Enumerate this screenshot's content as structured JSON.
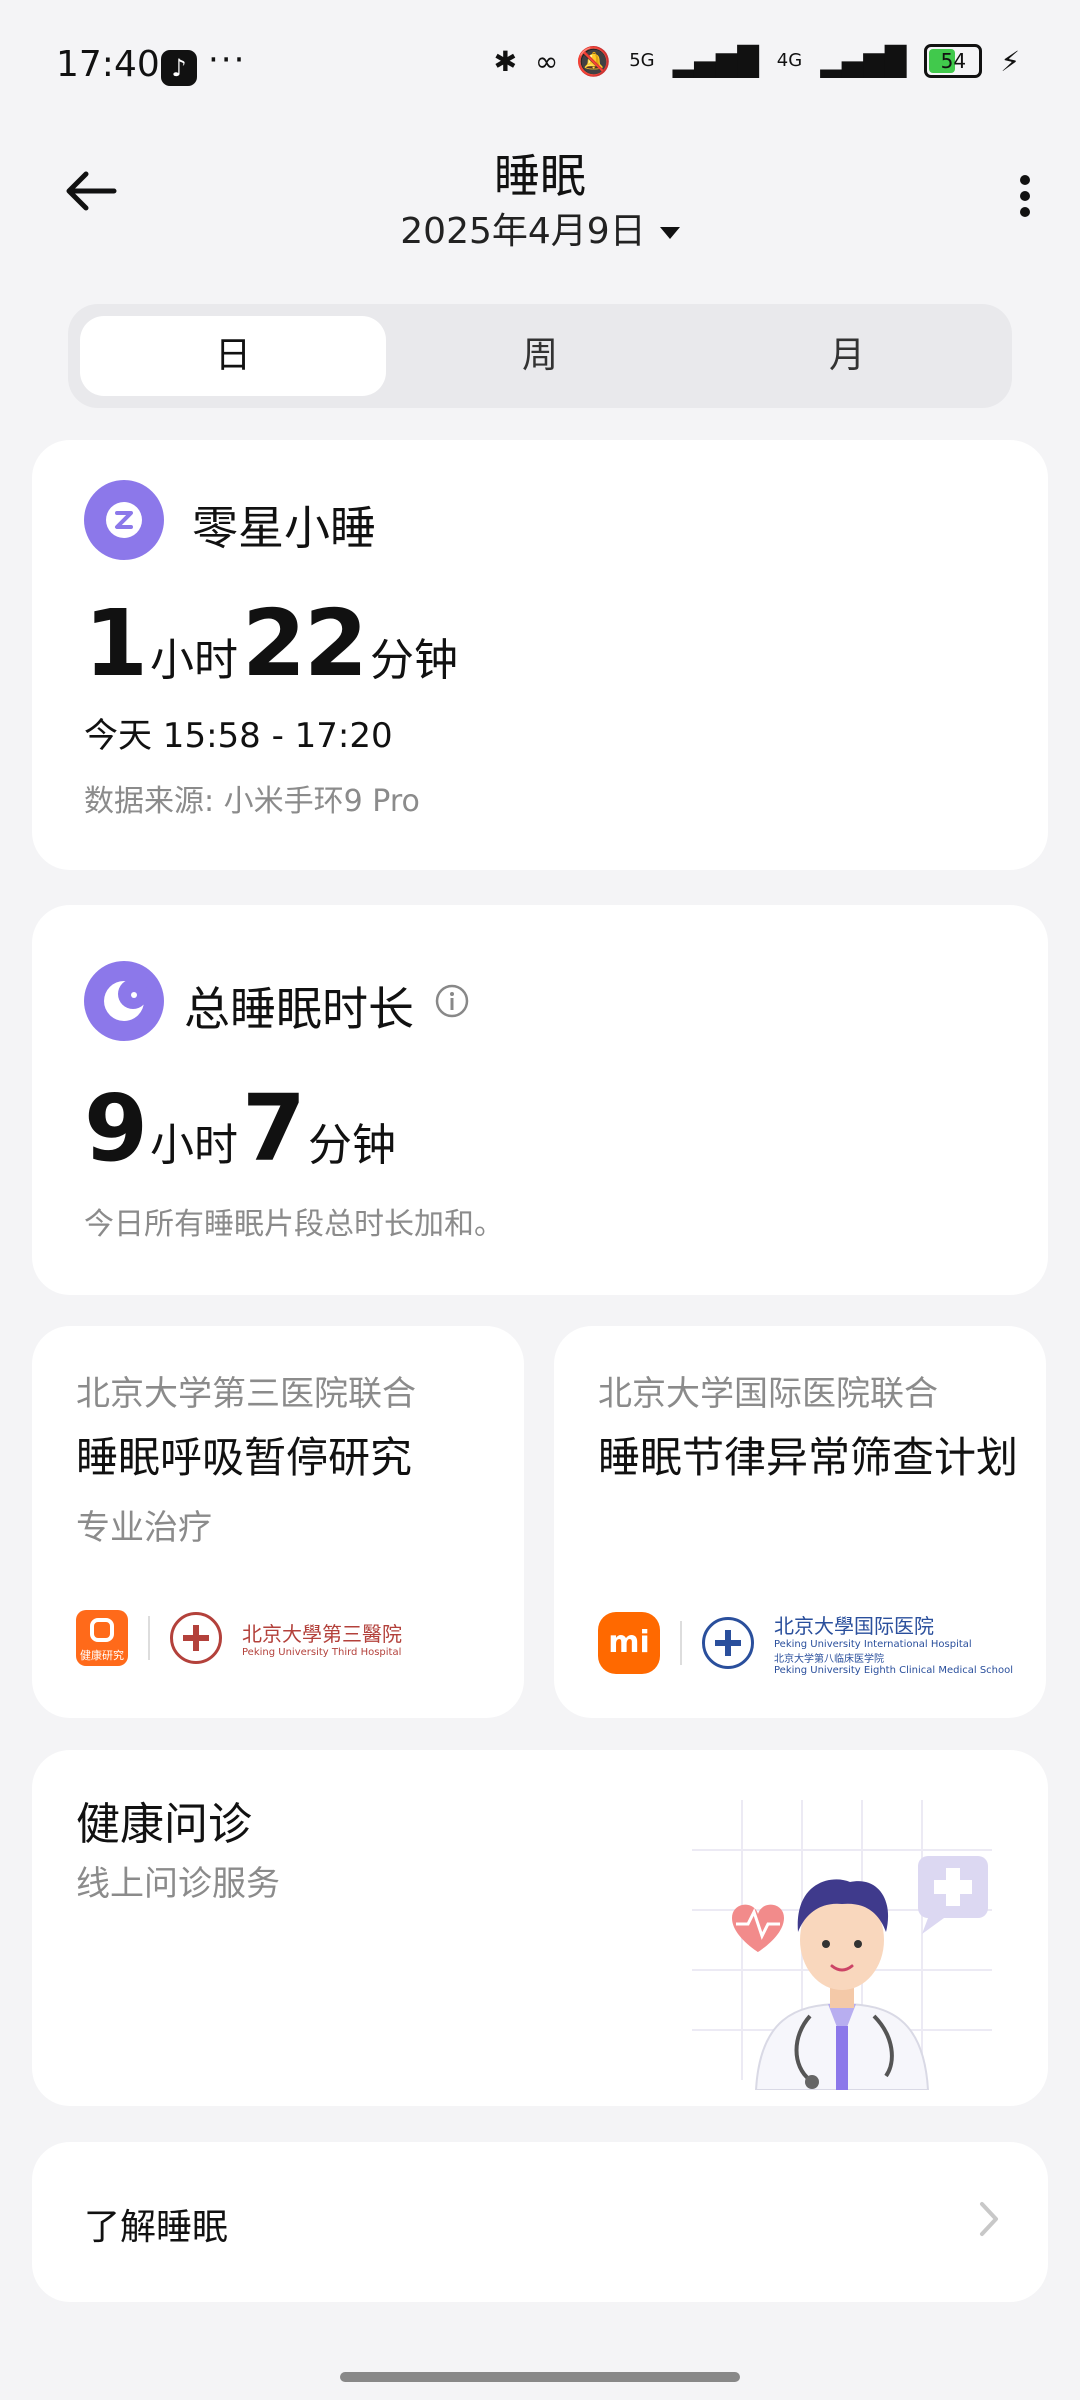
{
  "status_bar": {
    "time": "17:40",
    "dots": "···",
    "net1": "5G",
    "net2": "4G",
    "battery": "54"
  },
  "header": {
    "title": "睡眠",
    "date": "2025年4月9日"
  },
  "tabs": [
    {
      "label": "日",
      "active": true
    },
    {
      "label": "周",
      "active": false
    },
    {
      "label": "月",
      "active": false
    }
  ],
  "nap": {
    "title": "零星小睡",
    "hours": "1",
    "hours_unit": "小时",
    "minutes": "22",
    "minutes_unit": "分钟",
    "time_range": "今天 15:58 - 17:20",
    "source": "数据来源: 小米手环9 Pro"
  },
  "total": {
    "title": "总睡眠时长",
    "hours": "9",
    "hours_unit": "小时",
    "minutes": "7",
    "minutes_unit": "分钟",
    "description": "今日所有睡眠片段总时长加和。"
  },
  "studies": [
    {
      "partner": "北京大学第三医院联合",
      "title": "睡眠呼吸暂停研究",
      "subtitle": "专业治疗",
      "logo_text": "健康研究",
      "hospital_cn": "北京大學第三醫院",
      "hospital_en": "Peking University Third Hospital"
    },
    {
      "partner": "北京大学国际医院联合",
      "title": "睡眠节律异常筛查计划",
      "logo_text": "mi",
      "hospital_cn": "北京大學国际医院",
      "hospital_en": "Peking University International Hospital",
      "hospital_cn2": "北京大学第八临床医学院",
      "hospital_en2": "Peking University Eighth Clinical Medical School"
    }
  ],
  "consult": {
    "title": "健康问诊",
    "subtitle": "线上问诊服务"
  },
  "learn": {
    "label": "了解睡眠"
  },
  "colors": {
    "accent": "#8c78ea",
    "orange": "#ff6900",
    "background": "#f4f4f6"
  }
}
